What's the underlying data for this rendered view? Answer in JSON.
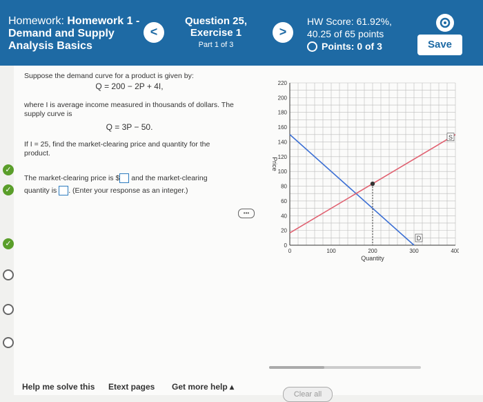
{
  "header": {
    "hw_prefix": "Homework: ",
    "hw_name": "Homework 1 - Demand and Supply Analysis Basics",
    "question_title": "Question 25, Exercise 1",
    "question_part": "Part 1 of 3",
    "hw_score": "HW Score: 61.92%, 40.25 of 65 points",
    "points": "Points: 0 of 3",
    "save_label": "Save",
    "prev_label": "<",
    "next_label": ">"
  },
  "problem": {
    "intro": "Suppose the demand curve for a product is given by:",
    "demand_eq": "Q = 200 − 2P + 4I,",
    "where": "where I is average income measured in thousands of dollars. The supply curve is",
    "supply_eq": "Q = 3P − 50.",
    "task": "If I = 25, find the market-clearing price and quantity for the product.",
    "ans_part1": "The market-clearing price is $",
    "ans_part2": " and the market-clearing quantity is ",
    "ans_part3": ". (Enter your response as an integer.)"
  },
  "chart_data": {
    "type": "line",
    "xlabel": "Quantity",
    "ylabel": "Price",
    "xlim": [
      0,
      400
    ],
    "ylim": [
      0,
      220
    ],
    "xticks": [
      0,
      100,
      200,
      300,
      400
    ],
    "yticks": [
      0,
      20,
      40,
      60,
      80,
      100,
      120,
      140,
      160,
      180,
      200,
      220
    ],
    "grid": true,
    "series": [
      {
        "name": "D",
        "color": "#3b6fd4",
        "points": [
          [
            0,
            150
          ],
          [
            300,
            0
          ]
        ]
      },
      {
        "name": "S",
        "color": "#e06070",
        "points": [
          [
            0,
            16.67
          ],
          [
            400,
            150
          ]
        ]
      }
    ],
    "equilibrium": {
      "x": 200,
      "y": 83.3
    }
  },
  "bottom": {
    "help": "Help me solve this",
    "etext": "Etext pages",
    "more_help": "Get more help",
    "clear_all": "Clear all"
  }
}
